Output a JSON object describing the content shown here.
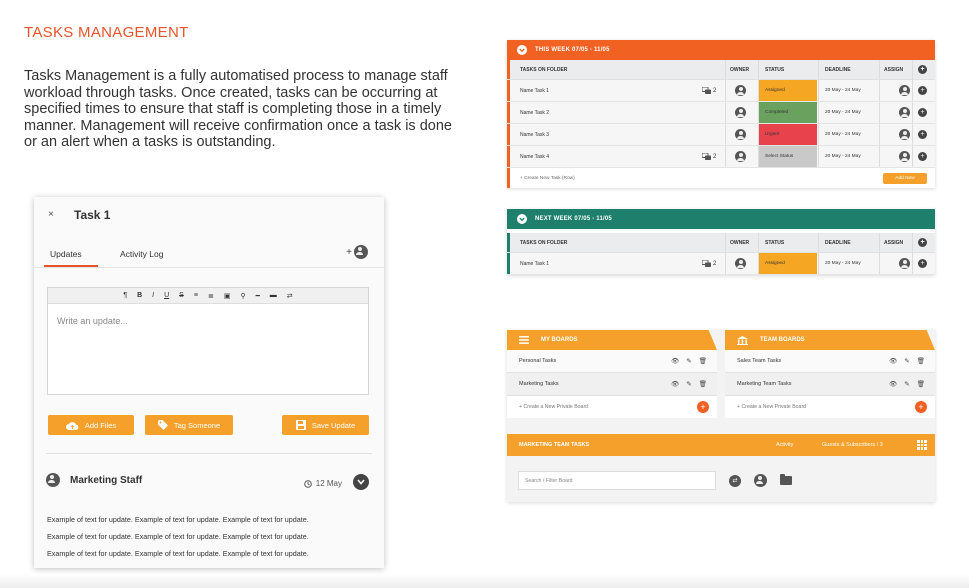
{
  "section": {
    "heading": "TASKS MANAGEMENT",
    "description": "Tasks Management is a fully automatised process to manage staff workload through tasks. Once created, tasks can be occurring at specified times to ensure that staff is completing those in a timely manner. Management will receive confirmation once a task is done or an alert when a tasks is outstanding."
  },
  "task_panel": {
    "close_glyph": "×",
    "title": "Task 1",
    "tabs": [
      "Updates",
      "Activity Log"
    ],
    "add_person_glyph": "+",
    "toolbar_glyphs": [
      "¶",
      "B",
      "I",
      "U",
      "S",
      "≡",
      "≣",
      "▣",
      "⚲",
      "━",
      "▬",
      "⇄"
    ],
    "editor_placeholder": "Write an update...",
    "buttons": {
      "add_files": "Add Files",
      "tag_someone": "Tag Someone",
      "save_update": "Save Update"
    },
    "update": {
      "author": "Marketing Staff",
      "date": "12 May",
      "lines": [
        "Example of text for update. Example of text for update.  Example of text for update.",
        "Example of text for update. Example of text for update.  Example of text for update.",
        "Example of text for update. Example of text for update.  Example of text for update."
      ]
    }
  },
  "this_week": {
    "title": "THIS WEEK 07/05 - 11/05",
    "color": "#f06122",
    "columns": {
      "folder": "TASKS ON FOLDER",
      "owner": "OWNER",
      "status": "STATUS",
      "deadline": "DEADLINE",
      "assign": "ASSIGN"
    },
    "rows": [
      {
        "name": "Name Task 1",
        "comments": "2",
        "status": "Assigned",
        "status_color": "#f5a623",
        "deadline": "20 May - 24 May"
      },
      {
        "name": "Name Task 2",
        "comments": "",
        "status": "Completed",
        "status_color": "#6aa15e",
        "deadline": "20 May - 24 May"
      },
      {
        "name": "Name Task 3",
        "comments": "",
        "status": "Urgent",
        "status_color": "#e8424d",
        "deadline": "20 May - 24 May"
      },
      {
        "name": "Name Task 4",
        "comments": "2",
        "status": "Select Status",
        "status_color": "#c9c9c9",
        "deadline": "20 May - 24 May"
      }
    ],
    "add_row": "+ Create New Task (Row)",
    "add_now": "Add Now"
  },
  "next_week": {
    "title": "NEXT WEEK 07/05 - 11/05",
    "color": "#1f7f6d",
    "columns": {
      "folder": "TASKS ON FOLDER",
      "owner": "OWNER",
      "status": "STATUS",
      "deadline": "DEADLINE",
      "assign": "ASSIGN"
    },
    "rows": [
      {
        "name": "Name Task 1",
        "comments": "2",
        "status": "Assigned",
        "status_color": "#f5a623",
        "deadline": "20 May - 24 May"
      }
    ]
  },
  "boards": {
    "my_boards": {
      "title": "MY BOARDS",
      "items": [
        "Personal Tasks",
        "Marketing Tasks"
      ],
      "create": "+ Create a New Private Board"
    },
    "team_boards": {
      "title": "TEAM BOARDS",
      "items": [
        "Sales Team Tasks",
        "Marketing Team Tasks"
      ],
      "create": "+ Create a New Private Board"
    },
    "marketing_team": {
      "title": "MARKETING TEAM TASKS",
      "activity": "Activity",
      "guests": "Guests & Subscribers / 3"
    },
    "filter_placeholder": "Search / Filter Board"
  }
}
